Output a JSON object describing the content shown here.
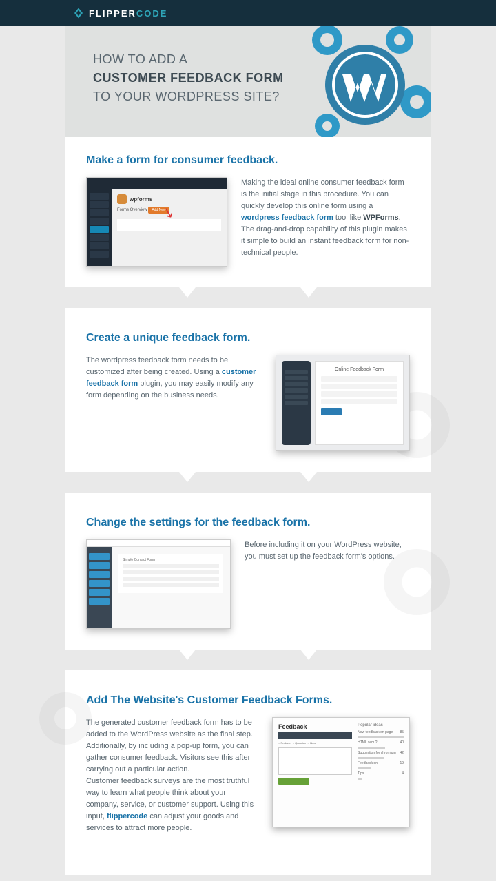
{
  "brand": {
    "flipper": "FLIPPER",
    "code": "CODE"
  },
  "hero": {
    "line1": "HOW TO ADD A",
    "line2": "CUSTOMER FEEDBACK FORM",
    "line3": "TO YOUR WORDPRESS SITE?"
  },
  "s1": {
    "title": "Make a form for consumer feedback.",
    "text1": "Making the ideal online consumer feedback form is the initial stage in this procedure. You can quickly develop this online form using a ",
    "link1": "wordpress feedback form",
    "text2": " tool like ",
    "bold1": "WPForms",
    "text3": ". The drag-and-drop capability of this plugin makes it simple to build an instant feedback form for non-technical people.",
    "shot_brand": "wpforms",
    "shot_overview": "Forms Overview",
    "shot_btn": "Add New"
  },
  "s2": {
    "title": "Create a unique feedback form.",
    "text1": "The wordpress feedback form needs to be customized after being created. Using a ",
    "link1": "customer feedback form",
    "text2": " plugin, you may easily modify any form depending on the business needs.",
    "shot_title": "Online Feedback Form"
  },
  "s3": {
    "title": "Change the settings for the feedback form.",
    "text1": "Before including it on your WordPress website, you must set up the feedback form's options.",
    "shot_title": "Simple Contact Form"
  },
  "s4": {
    "title": "Add The Website's Customer Feedback Forms.",
    "text1": "The generated customer feedback form has to be added to the WordPress website as the final step. Additionally, by including a pop-up form, you can gather consumer feedback. Visitors see this after carrying out a particular action.",
    "text2": "Customer feedback surveys are the most truthful way to learn what people think about your company, service, or customer support. Using this input, ",
    "link1": "flippercode",
    "text3": " can adjust your goods and services to attract more people.",
    "shot_fb": "Feedback",
    "shot_right_title": "Popular ideas"
  }
}
